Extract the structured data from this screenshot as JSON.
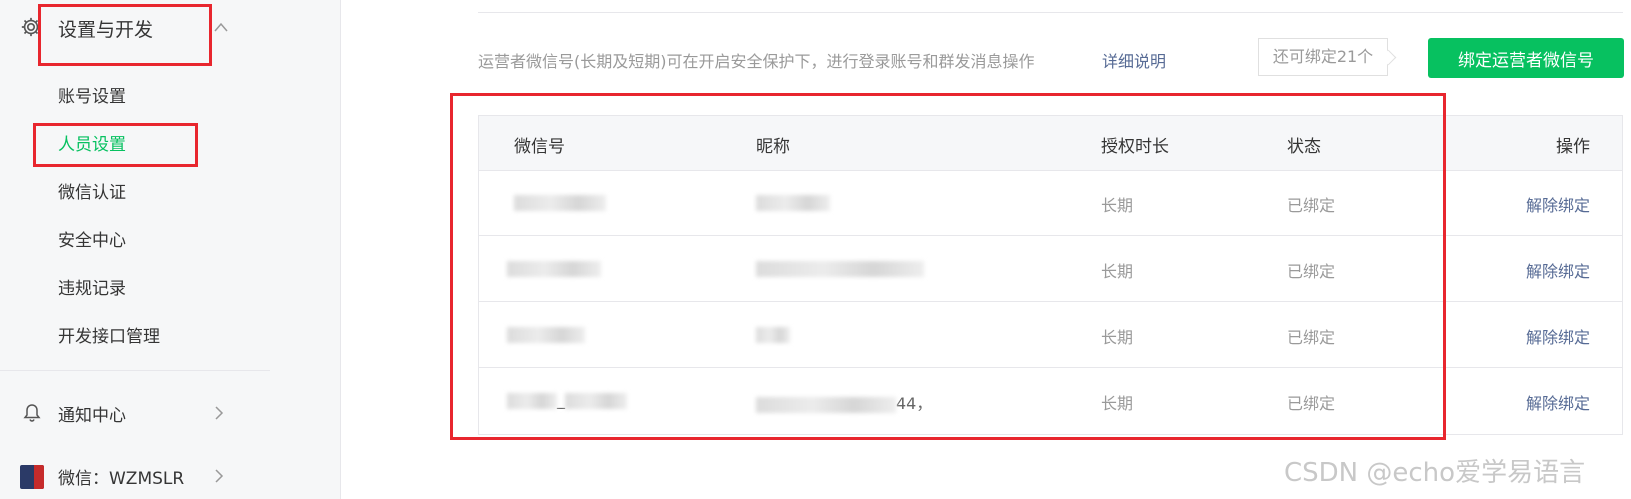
{
  "sidebar": {
    "section_title": "设置与开发",
    "items": [
      {
        "label": "账号设置",
        "active": false
      },
      {
        "label": "人员设置",
        "active": true
      },
      {
        "label": "微信认证",
        "active": false
      },
      {
        "label": "安全中心",
        "active": false
      },
      {
        "label": "违规记录",
        "active": false
      },
      {
        "label": "开发接口管理",
        "active": false
      }
    ],
    "notifications_label": "通知中心",
    "account_label": "微信：WZMSLR"
  },
  "main": {
    "info_text": "运营者微信号(长期及短期)可在开启安全保护下，进行登录账号和群发消息操作",
    "detail_link": "详细说明",
    "remaining_badge": "还可绑定21个",
    "bind_button": "绑定运营者微信号",
    "table": {
      "headers": [
        "微信号",
        "昵称",
        "授权时长",
        "状态",
        "操作"
      ],
      "rows": [
        {
          "wechat_id": "",
          "nickname": "",
          "duration": "长期",
          "status": "已绑定",
          "action": "解除绑定"
        },
        {
          "wechat_id": "",
          "nickname": "",
          "duration": "长期",
          "status": "已绑定",
          "action": "解除绑定"
        },
        {
          "wechat_id": "",
          "nickname": "",
          "duration": "长期",
          "status": "已绑定",
          "action": "解除绑定"
        },
        {
          "wechat_id": "_",
          "nickname": "44，",
          "duration": "长期",
          "status": "已绑定",
          "action": "解除绑定"
        }
      ]
    }
  },
  "watermark": "CSDN @echo爱学易语言",
  "colors": {
    "accent_green": "#07c160",
    "link_blue": "#576b95",
    "highlight_red": "#e8262e"
  }
}
